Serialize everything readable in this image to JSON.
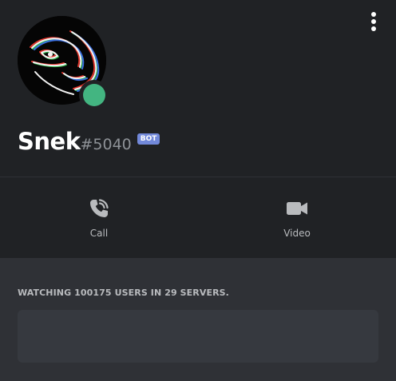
{
  "user": {
    "username": "Snek",
    "discriminator": "#5040",
    "badge": "BOT",
    "status": "online"
  },
  "actions": [
    {
      "label": "Call",
      "icon": "phone-icon"
    },
    {
      "label": "Video",
      "icon": "video-camera-icon"
    }
  ],
  "activity": {
    "title": "WATCHING 100175 USERS IN 29 SERVERS.",
    "note_value": ""
  },
  "icons": {
    "menu": "more-vertical-icon",
    "avatar": "avatar-image"
  },
  "colors": {
    "background": "#202225",
    "panel": "#2f3136",
    "input": "#36393f",
    "online_status": "#43b581",
    "bot_badge": "#7289da",
    "icon": "#b9bbbe"
  }
}
